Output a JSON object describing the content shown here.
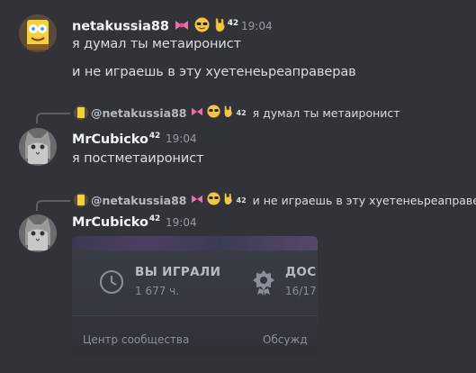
{
  "messages": [
    {
      "author": "netakussia88",
      "badge": "42",
      "time": "19:04",
      "lines": [
        "я думал ты метаиронист",
        "и не играешь в эту хуетенеьреаправерав"
      ]
    },
    {
      "reply_to": {
        "author": "@netakussia88",
        "badge": "42",
        "text": "я думал ты метаиронист"
      },
      "author": "MrCubicko",
      "badge": "42",
      "time": "19:04",
      "lines": [
        "я постметаиронист"
      ]
    },
    {
      "reply_to": {
        "author": "@netakussia88",
        "badge": "42",
        "text": "и не играешь в эту хуетенеьреаправе"
      },
      "author": "MrCubicko",
      "badge": "42",
      "time": "19:04",
      "embed": {
        "played_label": "ВЫ ИГРАЛИ",
        "played_value": "1 677 ч.",
        "achievements_label": "ДОС",
        "achievements_value": "16/17",
        "community_link": "Центр сообщества",
        "discussions_link": "Обсужд"
      }
    }
  ],
  "icons": {
    "bow": "pink-bow-icon",
    "sunglasses": "sunglasses-emoji-icon",
    "hand": "rock-hand-icon",
    "clock": "clock-icon",
    "achievement": "achievement-icon"
  },
  "colors": {
    "background": "#323339",
    "username": "#f2f3f5",
    "text": "#dbdee1",
    "timestamp": "#949ba4",
    "bow": "#f06fa8",
    "emoji_yellow": "#f4c542"
  }
}
